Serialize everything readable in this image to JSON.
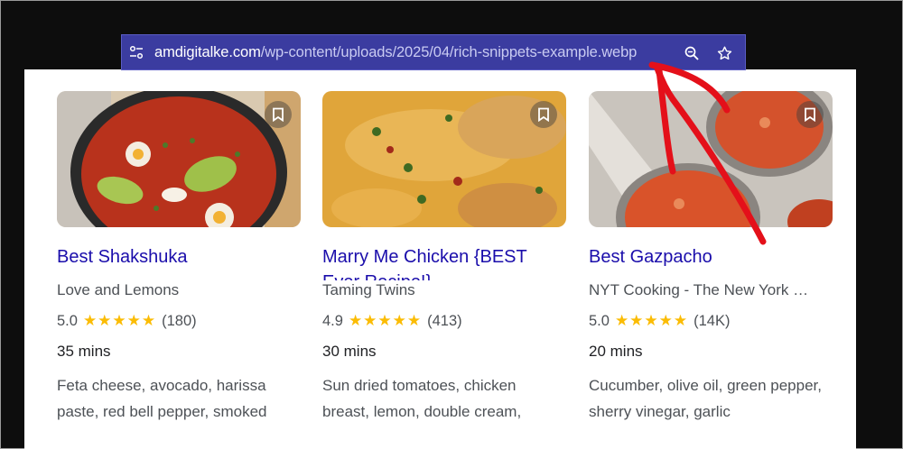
{
  "urlbar": {
    "domain": "amdigitalke.com",
    "path": "/wp-content/uploads/2025/04/rich-snippets-example.webp",
    "icons": [
      "site-settings-icon",
      "zoom-icon",
      "bookmark-star-icon"
    ]
  },
  "colors": {
    "link": "#1a0dab",
    "star": "#fbbc04",
    "urlbar_bg": "#3b3ca0",
    "annotation_arrow": "#e4101a"
  },
  "cards": [
    {
      "title": "Best Shakshuka",
      "source": "Love and Lemons",
      "rating": "5.0",
      "stars": "★★★★★",
      "reviews": "(180)",
      "time": "35 mins",
      "description": "Feta cheese, avocado, harissa paste, red bell pepper, smoked"
    },
    {
      "title": "Marry Me Chicken {BEST Ever Recipe!}",
      "source": "Taming Twins",
      "rating": "4.9",
      "stars": "★★★★★",
      "reviews": "(413)",
      "time": "30 mins",
      "description": "Sun dried tomatoes, chicken breast, lemon, double cream,"
    },
    {
      "title": "Best Gazpacho",
      "source": "NYT Cooking - The New York …",
      "rating": "5.0",
      "stars": "★★★★★",
      "reviews": "(14K)",
      "time": "20 mins",
      "description": "Cucumber, olive oil, green pepper, sherry vinegar, garlic"
    }
  ]
}
